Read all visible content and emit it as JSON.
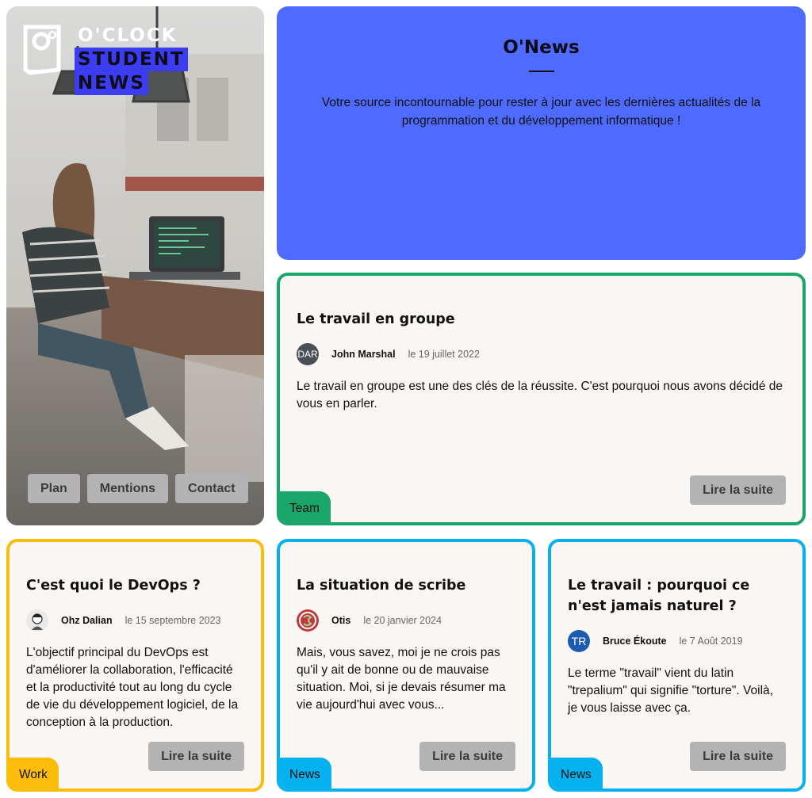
{
  "brand": {
    "logo_lines": [
      "O'CLOCK",
      "STUDENT",
      "NEWS"
    ],
    "icon": "oclock-logo-icon"
  },
  "hero_nav": [
    "Plan",
    "Mentions",
    "Contact"
  ],
  "banner": {
    "title": "O'News",
    "description": "Votre source incontournable pour rester à jour avec les dernières actualités de la programmation et du développement informatique !"
  },
  "colors": {
    "banner": "#4f6bfd",
    "team": "#1aa56a",
    "work": "#fbbd09",
    "news": "#05b1ef",
    "button": "#b3b3b3",
    "card_bg": "#f9f6f3"
  },
  "articles": [
    {
      "title": "Le travail en groupe",
      "avatar_text": "DAR",
      "author": "John Marshal",
      "date": "le 19 juillet 2022",
      "excerpt": "Le travail en groupe est une des clés de la réussite. C'est pourquoi nous avons décidé de vous en parler.",
      "button": "Lire la suite",
      "category": "Team"
    },
    {
      "title": "C'est quoi le DevOps ?",
      "avatar_text": "",
      "author": "Ohz Dalian",
      "date": "le 15 septembre 2023",
      "excerpt": "L'objectif principal du DevOps est d'améliorer la collaboration, l'efficacité et la productivité tout au long du cycle de vie du développement logiciel, de la conception à la production.",
      "button": "Lire la suite",
      "category": "Work"
    },
    {
      "title": "La situation de scribe",
      "avatar_text": "",
      "author": "Otis",
      "date": "le 20 janvier 2024",
      "excerpt": "Mais, vous savez, moi je ne crois pas qu'il y ait de bonne ou de mauvaise situation. Moi, si je devais résumer ma vie aujourd'hui avec vous...",
      "button": "Lire la suite",
      "category": "News"
    },
    {
      "title": "Le travail : pourquoi ce n'est jamais naturel ?",
      "avatar_text": "TR",
      "author": "Bruce Ékoute",
      "date": "le 7 Août 2019",
      "excerpt": "Le terme \"travail\" vient du latin \"trepalium\" qui signifie \"torture\". Voilà, je vous laisse avec ça.",
      "button": "Lire la suite",
      "category": "News"
    }
  ]
}
